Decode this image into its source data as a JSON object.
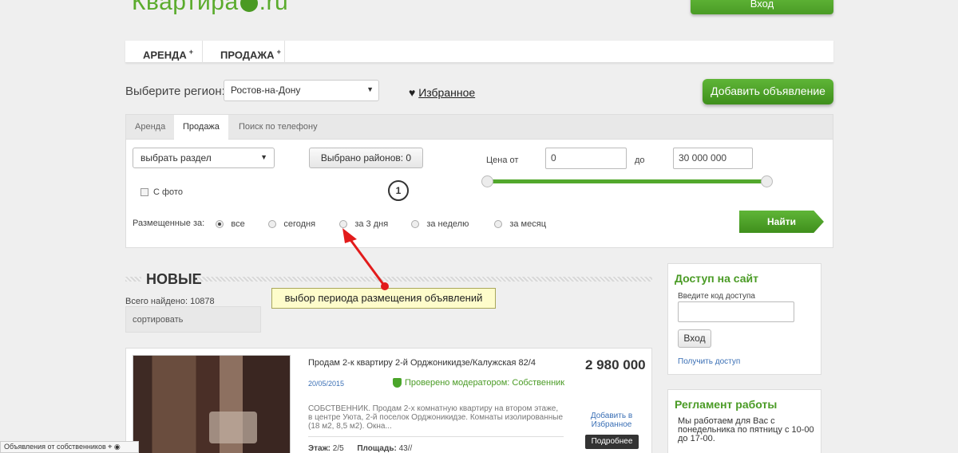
{
  "logo": {
    "left": "Квартира",
    "right": ".ru"
  },
  "top_login": "Вход",
  "nav": [
    {
      "label": "АРЕНДА",
      "sup": "+"
    },
    {
      "label": "ПРОДАЖА",
      "sup": "+"
    }
  ],
  "region": {
    "label": "Выберите регион:",
    "value": "Ростов-на-Дону"
  },
  "favorites": {
    "icon": "♥",
    "label": "Избранное"
  },
  "add_button": "Добавить объявление",
  "filter": {
    "tabs": [
      "Аренда",
      "Продажа",
      "Поиск по телефону"
    ],
    "active_tab": "Продажа",
    "section_select": "выбрать раздел",
    "districts_button": "Выбрано районов: 0",
    "price_from_label": "Цена от",
    "price_from": "0",
    "price_to_label": "до",
    "price_to": "30 000 000",
    "with_photo": "С фото",
    "annotation_number": "1",
    "period_label": "Размещенные за:",
    "period_options": [
      "все",
      "сегодня",
      "за 3 дня",
      "за неделю",
      "за месяц"
    ],
    "period_selected": "все",
    "find_button": "Найти"
  },
  "results": {
    "heading": "НОВЫЕ",
    "total": "Всего найдено: 10878",
    "sort": "сортировать"
  },
  "tooltip": "выбор периода размещения объявлений",
  "listing": {
    "title": "Продам 2-к квартиру 2-й Орджоникидзе/Калужская 82/4",
    "price": "2 980 000",
    "date": "20/05/2015",
    "verified": "Проверено модератором: Собственник",
    "description": "СОБСТВЕННИК. Продам 2-х комнатную квартиру на втором этаже, в центре Уюта, 2-й поселок Орджоникидзе. Комнаты изолированные (18 м2, 8,5 м2). Окна...",
    "add_fav": "Добавить в Избранное",
    "details": "Подробнее",
    "floor_label": "Этаж:",
    "floor": "2/5",
    "area_label": "Площадь:",
    "area": "43//"
  },
  "sidebar": {
    "access": {
      "title": "Доступ на сайт",
      "code_label": "Введите код доступа",
      "login_button": "Вход",
      "get_access": "Получить доступ"
    },
    "schedule": {
      "title": "Регламент работы",
      "text": "Мы работаем для Вас с понедельника по пятницу с 10-00 до 17-00."
    }
  },
  "status_bar": "Объявления от собственников",
  "colors": {
    "accent": "#4a9b25",
    "link": "#3a6fb5",
    "arrow": "#e21b1b"
  }
}
